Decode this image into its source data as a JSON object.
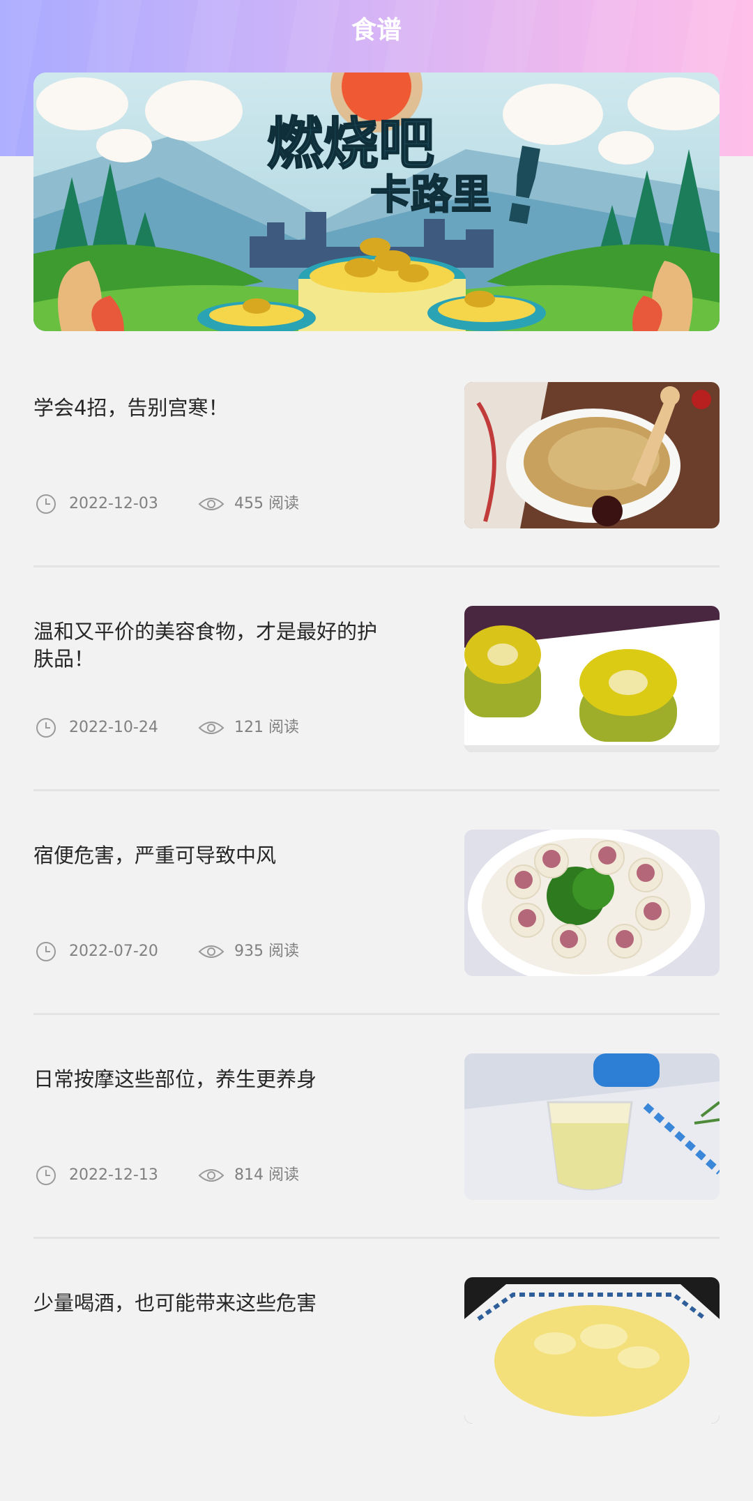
{
  "header": {
    "title": "食谱"
  },
  "banner": {
    "line1": "燃烧吧",
    "line2": "卡路里",
    "mark": "!"
  },
  "articles": [
    {
      "title": "学会4招，告别宫寒！",
      "date": "2022-12-03",
      "views": "455 阅读",
      "thumb_desc": "chicken-soup"
    },
    {
      "title": "温和又平价的美容食物，才是最好的护肤品！",
      "date": "2022-10-24",
      "views": "121 阅读",
      "thumb_desc": "kiwi-slices"
    },
    {
      "title": "宿便危害，严重可导致中风",
      "date": "2022-07-20",
      "views": "935 阅读",
      "thumb_desc": "meat-radish-rings"
    },
    {
      "title": "日常按摩这些部位，养生更养身",
      "date": "2022-12-13",
      "views": "814 阅读",
      "thumb_desc": "juice-glass"
    },
    {
      "title": "少量喝酒，也可能带来这些危害",
      "date": "",
      "views": "",
      "thumb_desc": "egg-dish"
    }
  ],
  "colors": {
    "header_start": "#a9abff",
    "header_end": "#ffbfe9",
    "background": "#f2f2f2",
    "text": "#262626",
    "meta": "#808080"
  }
}
